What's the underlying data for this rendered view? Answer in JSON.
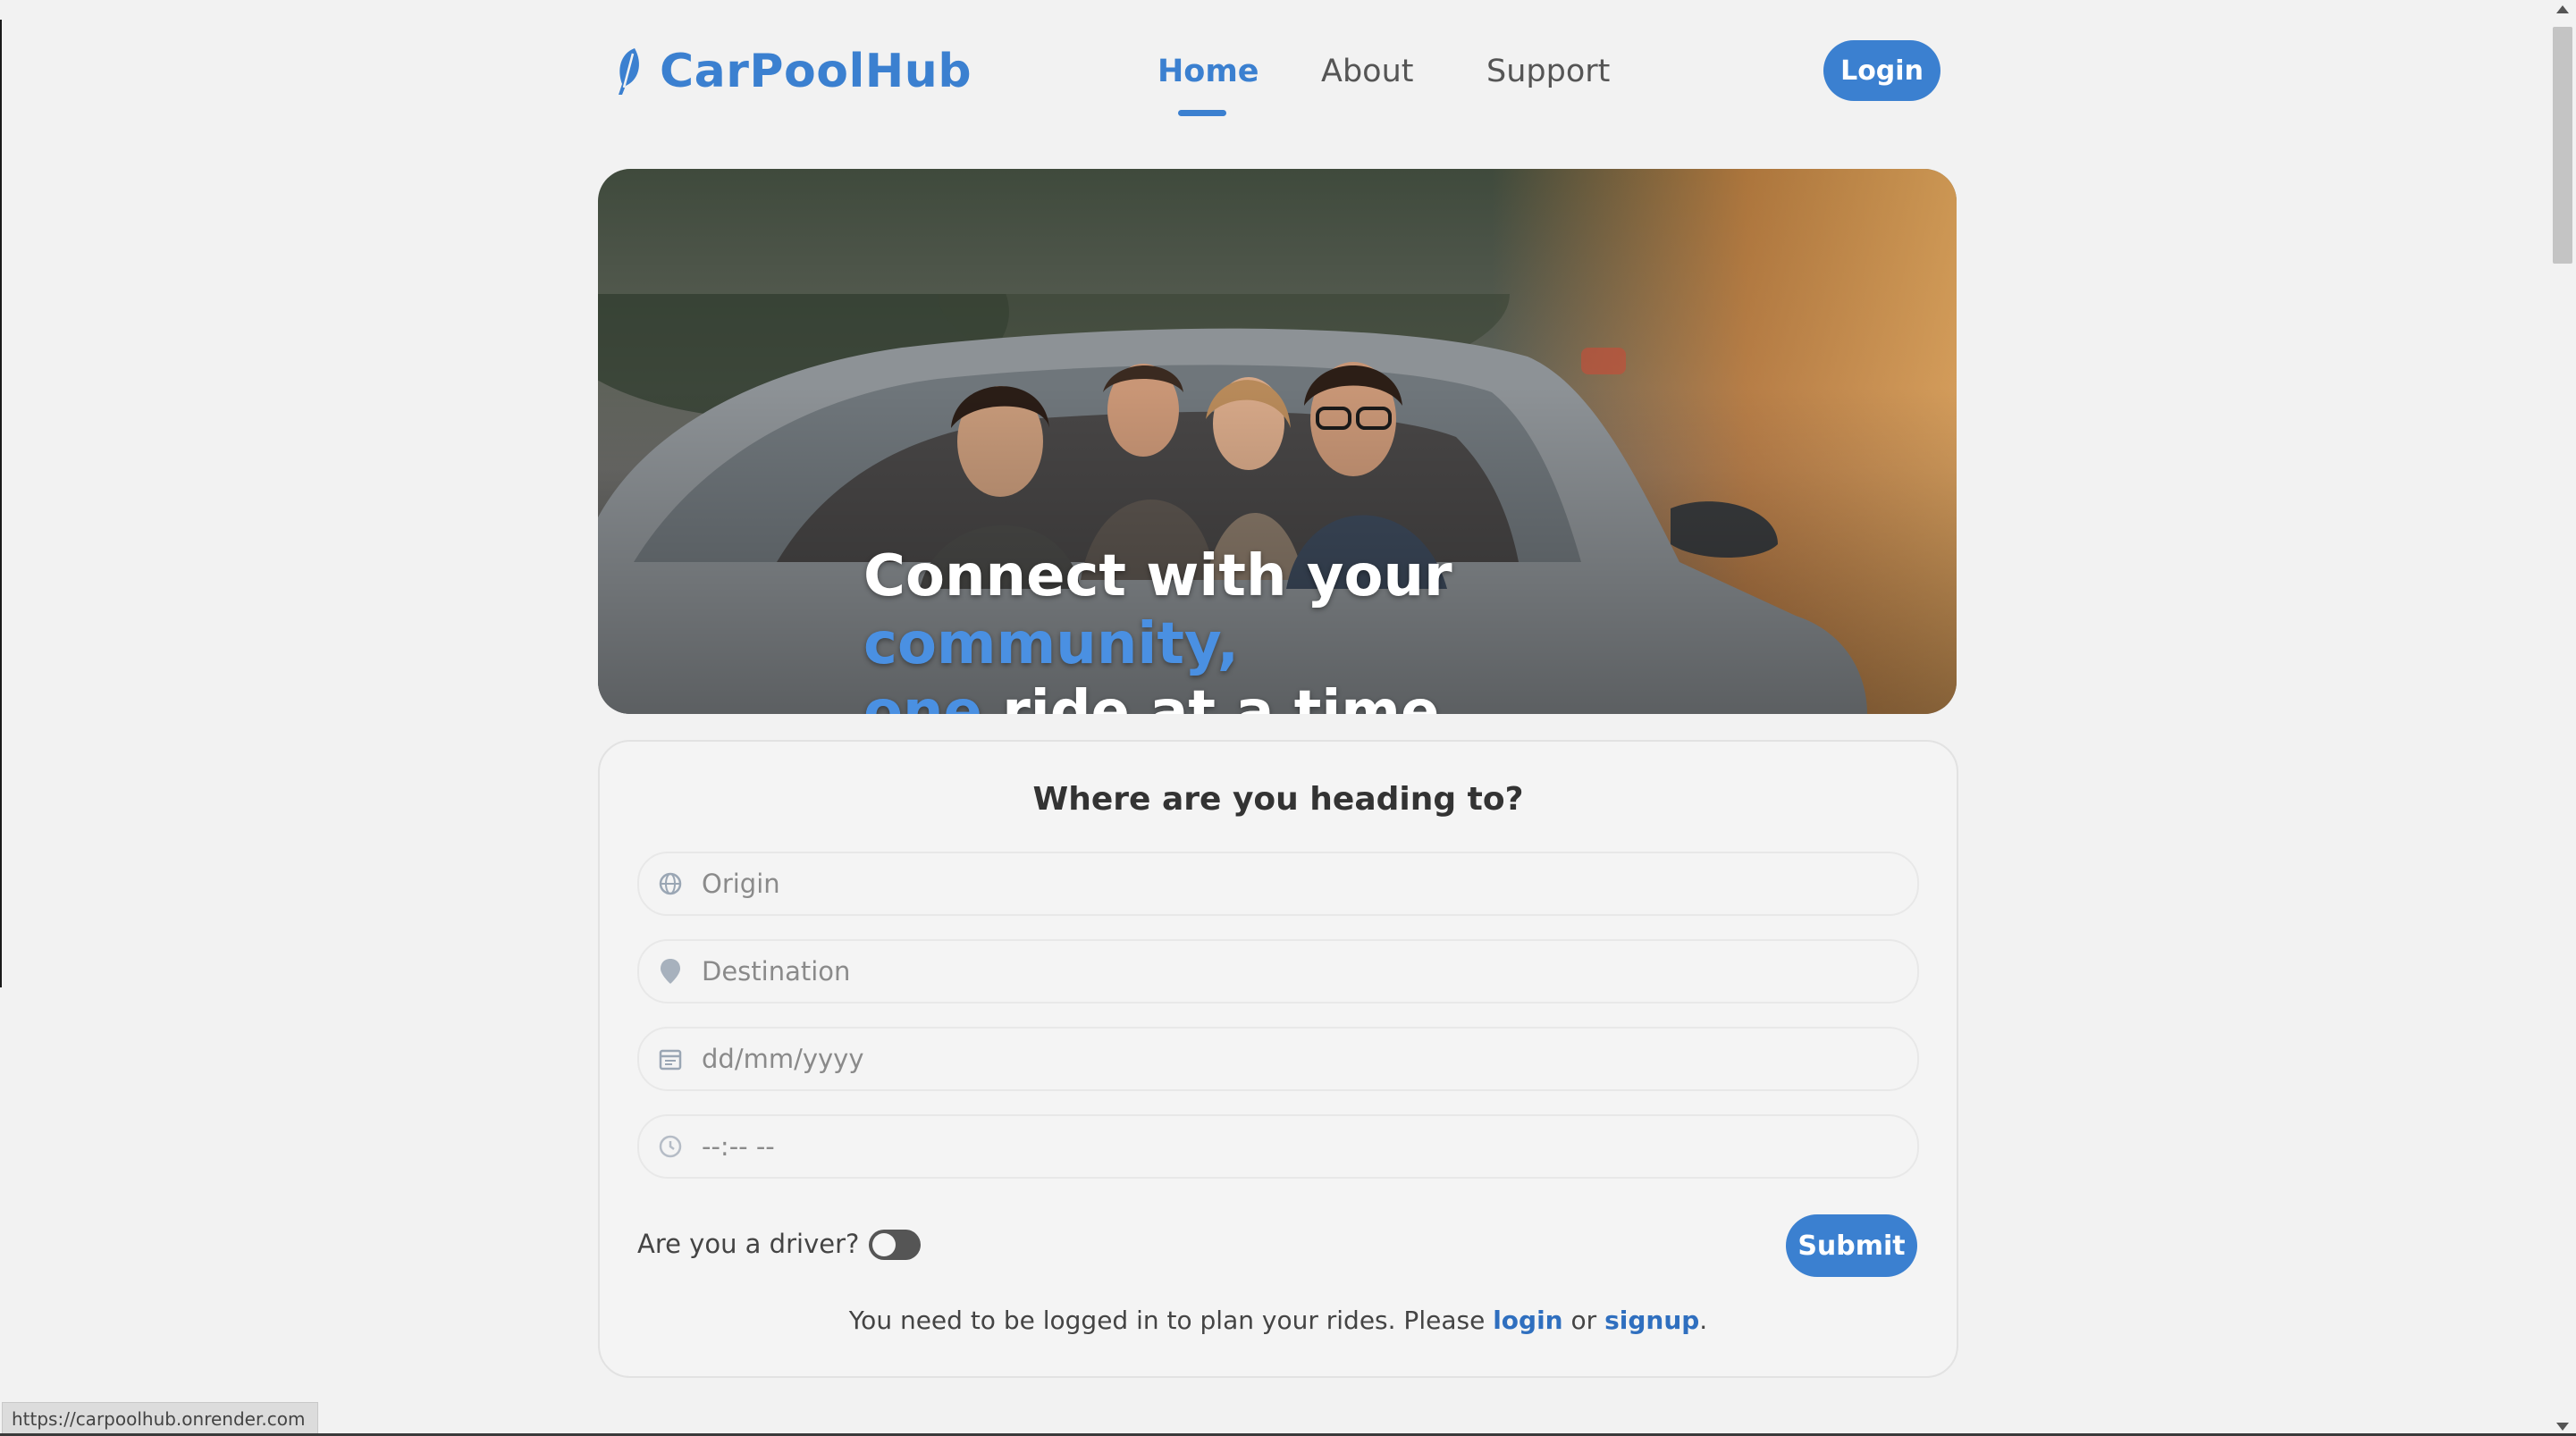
{
  "header": {
    "logo_text": "CarPoolHub",
    "logo_icon": "feather-icon",
    "nav": [
      {
        "label": "Home",
        "active": true
      },
      {
        "label": "About",
        "active": false
      },
      {
        "label": "Support",
        "active": false
      }
    ],
    "login_label": "Login"
  },
  "hero": {
    "line1_white": "Connect with your ",
    "line1_blue": "community,",
    "line2_blue": "one",
    "line2_white": " ride at a time."
  },
  "form": {
    "title": "Where are you heading to?",
    "fields": {
      "origin": {
        "placeholder": "Origin",
        "icon": "globe-icon"
      },
      "destination": {
        "placeholder": "Destination",
        "icon": "location-pin-icon"
      },
      "date": {
        "placeholder": "dd/mm/yyyy",
        "icon": "calendar-icon"
      },
      "time": {
        "placeholder": "--:-- --",
        "icon": "clock-icon"
      }
    },
    "driver_label": "Are you a driver?",
    "driver_toggle_on": false,
    "submit_label": "Submit",
    "note_prefix": "You need to be logged in to plan your rides. Please ",
    "note_login": "login",
    "note_or": " or ",
    "note_signup": "signup",
    "note_suffix": "."
  },
  "status_bar": {
    "url": "https://carpoolhub.onrender.com"
  },
  "colors": {
    "accent": "#3b80d0",
    "highlight": "#4a90e2",
    "background": "#f2f2f2"
  }
}
